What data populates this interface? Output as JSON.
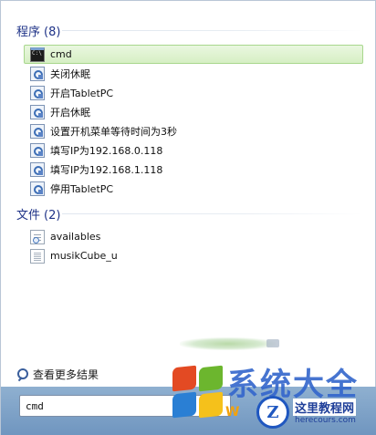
{
  "programs": {
    "title": "程序",
    "count": "(8)",
    "items": [
      {
        "label": "cmd",
        "icon": "cmd-icon",
        "selected": true
      },
      {
        "label": "关闭休眠",
        "icon": "script-icon"
      },
      {
        "label": "开启TabletPC",
        "icon": "script-icon"
      },
      {
        "label": "开启休眠",
        "icon": "script-icon"
      },
      {
        "label": "设置开机菜单等待时间为3秒",
        "icon": "script-icon"
      },
      {
        "label": "填写IP为192.168.0.118",
        "icon": "script-icon"
      },
      {
        "label": "填写IP为192.168.1.118",
        "icon": "script-icon"
      },
      {
        "label": "停用TabletPC",
        "icon": "script-icon"
      }
    ]
  },
  "files": {
    "title": "文件",
    "count": "(2)",
    "items": [
      {
        "label": "availables",
        "icon": "file-icon"
      },
      {
        "label": "musikCube_u",
        "icon": "text-file-icon"
      }
    ]
  },
  "see_more": "查看更多结果",
  "search": {
    "value": "cmd"
  },
  "watermark": {
    "big_text": "系统大全",
    "w_letter": "W",
    "badge_letter": "Z",
    "site_name": "这里教程网",
    "site_url": "herecours.com"
  },
  "colors": {
    "section_title": "#1e3287",
    "selected_bg": "#d6efc4",
    "selected_border": "#a8d78d",
    "bottom_bar": "#7f9fc6"
  }
}
